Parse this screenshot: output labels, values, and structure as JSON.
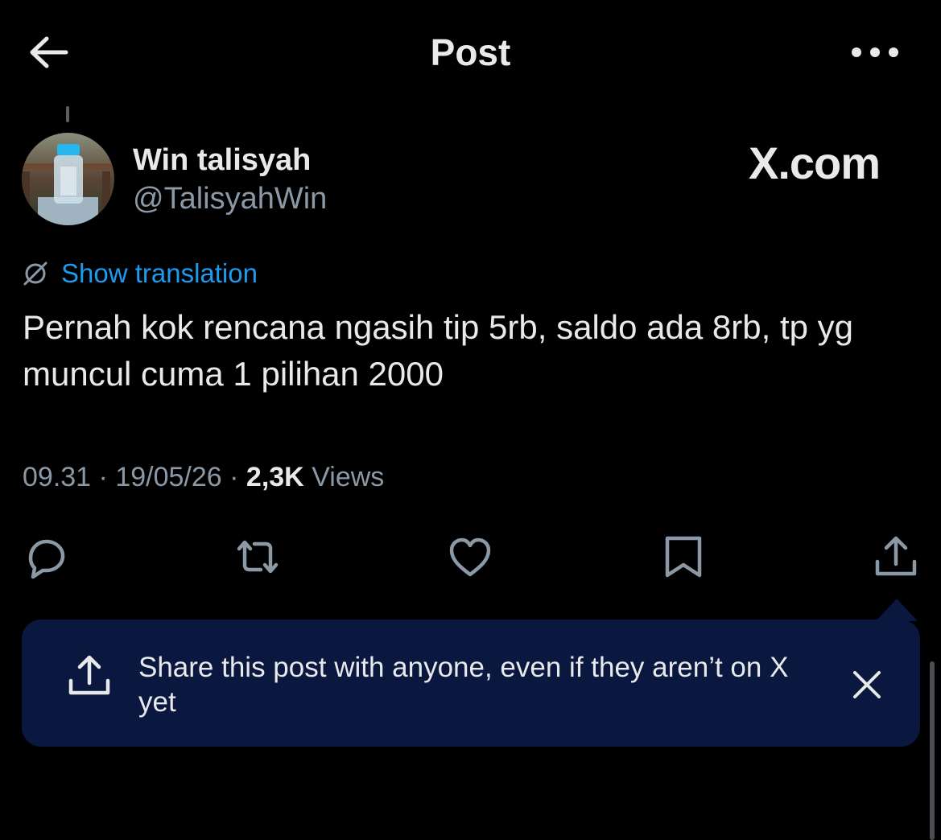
{
  "header": {
    "title": "Post",
    "back_icon": "arrow-left-icon",
    "more_icon": "more-horizontal-icon"
  },
  "post": {
    "author_name": "Win talisyah",
    "author_handle": "@TalisyahWin",
    "watermark": "X.com",
    "translation_label": "Show translation",
    "text": "Pernah kok rencana ngasih tip 5rb, saldo ada 8rb, tp yg muncul cuma 1 pilihan 2000",
    "time": "09.31",
    "date": "19/05/26",
    "separator": "·",
    "views_count": "2,3K",
    "views_label": "Views"
  },
  "actions": [
    "reply-icon",
    "repost-icon",
    "like-icon",
    "bookmark-icon",
    "share-icon"
  ],
  "tooltip": {
    "text": "Share this post with anyone, even if they aren’t on X yet",
    "icon": "share-icon",
    "close_icon": "close-icon"
  },
  "colors": {
    "background": "#000000",
    "link": "#1d9bf0",
    "secondary_text": "#8b98a5",
    "tooltip_bg": "#0a173e"
  }
}
